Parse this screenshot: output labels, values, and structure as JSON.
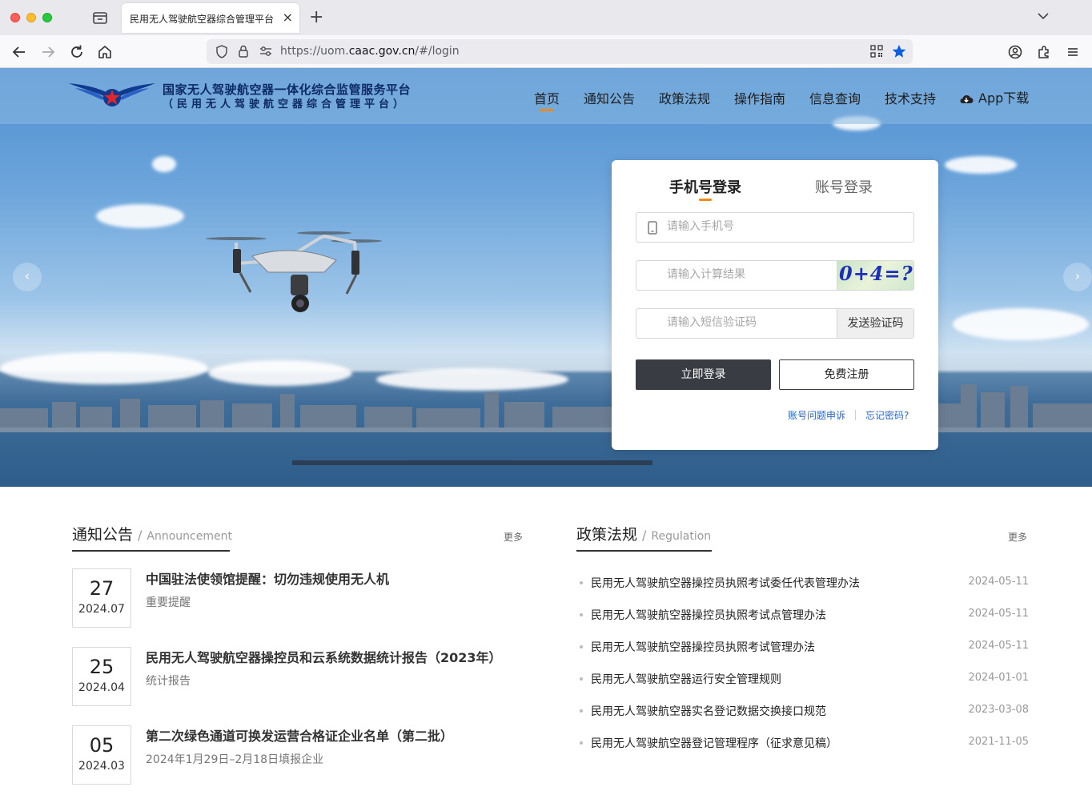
{
  "browser": {
    "tab_title": "民用无人驾驶航空器综合管理平台（UOM）",
    "new_tab": "+",
    "tab_close": "×",
    "url_prefix": "https://uom.",
    "url_host": "caac.gov.cn",
    "url_suffix": "/#/login"
  },
  "header": {
    "logo_line1": "国家无人驾驶航空器一体化综合监管服务平台",
    "logo_line2": "（民用无人驾驶航空器综合管理平台）",
    "nav": [
      "首页",
      "通知公告",
      "政策法规",
      "操作指南",
      "信息查询",
      "技术支持"
    ],
    "app_download": "App下载",
    "active_nav": "首页"
  },
  "carousel": {
    "prev": "‹",
    "next": "›"
  },
  "login": {
    "tab_phone": "手机号登录",
    "tab_account": "账号登录",
    "phone_placeholder": "请输入手机号",
    "calc_placeholder": "请输入计算结果",
    "captcha_text": "0+4=?",
    "sms_placeholder": "请输入短信验证码",
    "sms_button": "发送验证码",
    "login_button": "立即登录",
    "register_button": "免费注册",
    "appeal_link": "账号问题申诉",
    "forgot_link": "忘记密码?"
  },
  "announcements": {
    "title": "通知公告",
    "title_en": "Announcement",
    "more": "更多",
    "items": [
      {
        "day": "27",
        "ym": "2024.07",
        "title": "中国驻法使领馆提醒：切勿违规使用无人机",
        "sub": "重要提醒"
      },
      {
        "day": "25",
        "ym": "2024.04",
        "title": "民用无人驾驶航空器操控员和云系统数据统计报告（2023年）",
        "sub": "统计报告"
      },
      {
        "day": "05",
        "ym": "2024.03",
        "title": "第二次绿色通道可换发运营合格证企业名单（第二批）",
        "sub": "2024年1月29日–2月18日填报企业"
      }
    ]
  },
  "regulations": {
    "title": "政策法规",
    "title_en": "Regulation",
    "more": "更多",
    "items": [
      {
        "title": "民用无人驾驶航空器操控员执照考试委任代表管理办法",
        "date": "2024-05-11"
      },
      {
        "title": "民用无人驾驶航空器操控员执照考试点管理办法",
        "date": "2024-05-11"
      },
      {
        "title": "民用无人驾驶航空器操控员执照考试管理办法",
        "date": "2024-05-11"
      },
      {
        "title": "民用无人驾驶航空器运行安全管理规则",
        "date": "2024-01-01"
      },
      {
        "title": "民用无人驾驶航空器实名登记数据交换接口规范",
        "date": "2023-03-08"
      },
      {
        "title": "民用无人驾驶航空器登记管理程序（征求意见稿）",
        "date": "2021-11-05"
      }
    ]
  },
  "colors": {
    "accent": "#ef8a1b",
    "link": "#2a67c6",
    "primary_button": "#393c42"
  }
}
